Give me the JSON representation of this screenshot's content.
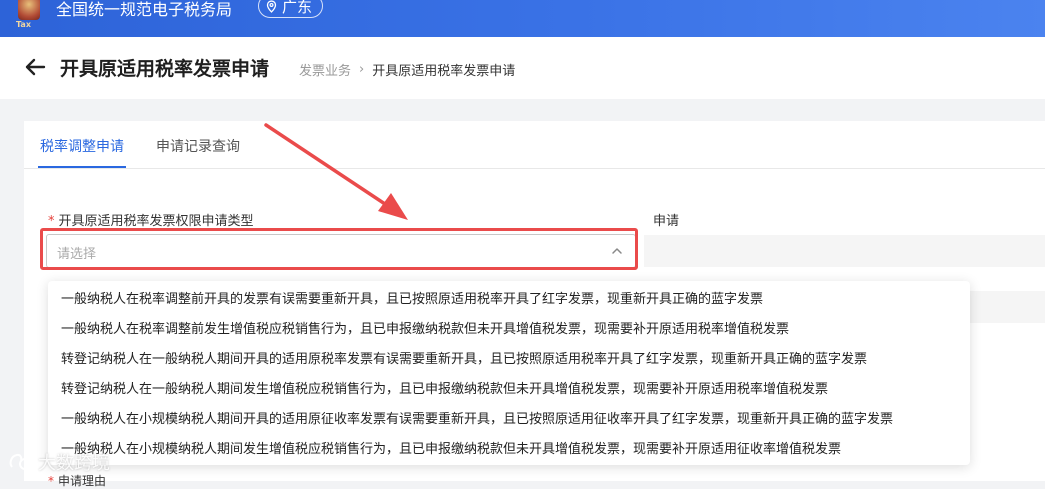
{
  "header": {
    "site_title": "全国统一规范电子税务局",
    "logo_text": "Tax",
    "region": "广东"
  },
  "page": {
    "title": "开具原适用税率发票申请",
    "breadcrumb": [
      "发票业务",
      "开具原适用税率发票申请"
    ]
  },
  "tabs": [
    {
      "label": "税率调整申请",
      "active": true
    },
    {
      "label": "申请记录查询",
      "active": false
    }
  ],
  "form": {
    "type_label": "开具原适用税率发票权限申请类型",
    "type_placeholder": "请选择",
    "second_label": "申请",
    "reason_label": "申请理由"
  },
  "dropdown_options": [
    "一般纳税人在税率调整前开具的发票有误需要重新开具，且已按照原适用税率开具了红字发票，现重新开具正确的蓝字发票",
    "一般纳税人在税率调整前发生增值税应税销售行为，且已申报缴纳税款但未开具增值税发票，现需要补开原适用税率增值税发票",
    "转登记纳税人在一般纳税人期间开具的适用原税率发票有误需要重新开具，且已按照原适用税率开具了红字发票，现重新开具正确的蓝字发票",
    "转登记纳税人在一般纳税人期间发生增值税应税销售行为，且已申报缴纳税款但未开具增值税发票，现需要补开原适用税率增值税发票",
    "一般纳税人在小规模纳税人期间开具的适用原征收率发票有误需要重新开具，且已按照原适用征收率开具了红字发票，现重新开具正确的蓝字发票",
    "一般纳税人在小规模纳税人期间发生增值税应税销售行为，且已申报缴纳税款但未开具增值税发票，现需要补开原适用征收率增值税发票"
  ],
  "watermark": "大数跨境",
  "colors": {
    "header_blue": "#3a72e6",
    "accent": "#2a68e0",
    "annotation_red": "#ea4b4b",
    "required": "#e5403a"
  }
}
